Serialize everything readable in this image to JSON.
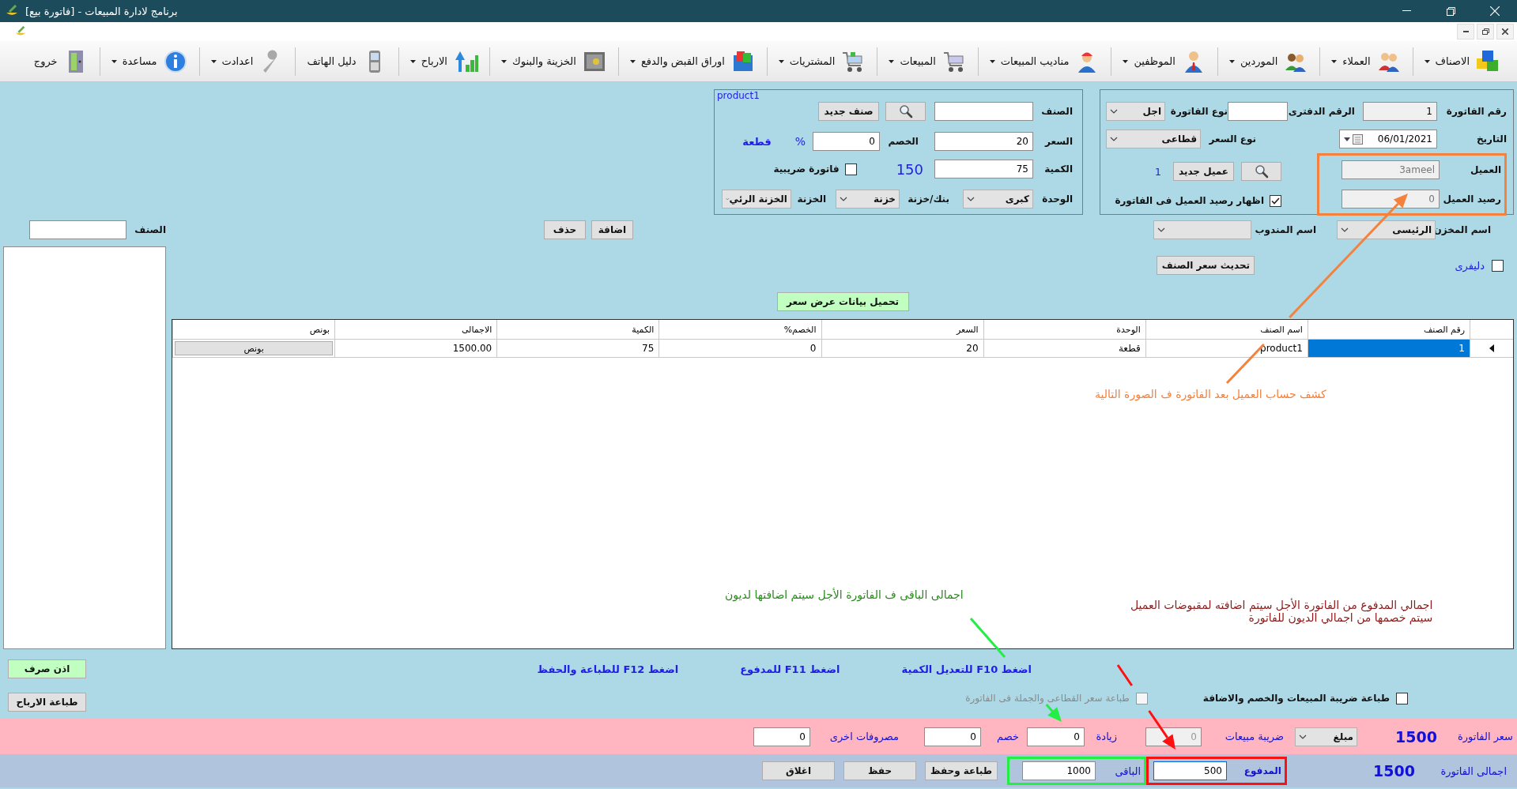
{
  "window": {
    "title": "برنامج لادارة المبيعات - [فاتورة بيع]"
  },
  "toolbar": [
    {
      "label": "الاصناف",
      "dropdown": true
    },
    {
      "label": "العملاء",
      "dropdown": true
    },
    {
      "label": "الموردين",
      "dropdown": true
    },
    {
      "label": "الموظفين",
      "dropdown": true
    },
    {
      "label": "مناديب المبيعات",
      "dropdown": true
    },
    {
      "label": "المبيعات",
      "dropdown": true
    },
    {
      "label": "المشتريات",
      "dropdown": true
    },
    {
      "label": "اوراق القبض والدفع",
      "dropdown": true
    },
    {
      "label": "الخزينة والبنوك",
      "dropdown": true
    },
    {
      "label": "الارباح",
      "dropdown": true
    },
    {
      "label": "دليل الهاتف",
      "dropdown": false
    },
    {
      "label": "اعدادت",
      "dropdown": true
    },
    {
      "label": "مساعدة",
      "dropdown": true
    },
    {
      "label": "خروج",
      "dropdown": false
    }
  ],
  "invoice": {
    "number": {
      "label": "رقم الفاتورة",
      "value": "1"
    },
    "book_number": {
      "label": "الرقم الدفترى"
    },
    "invoice_type": {
      "label": "نوع الفاتورة",
      "value": "اجل"
    },
    "date": {
      "label": "التاريخ",
      "value": "06/01/2021"
    },
    "price_type": {
      "label": "نوع السعر",
      "value": "قطاعى"
    },
    "customer": {
      "label": "العميل",
      "value": "3ameel"
    },
    "balance": {
      "label": "رصيد العميل",
      "value": "0"
    },
    "new_customer_button": "عميل جديد",
    "customer_count": "1",
    "show_balance": {
      "label": "اظهار رصيد العميل فى الفاتورة",
      "checked": true
    }
  },
  "item": {
    "caption": "product1",
    "item": {
      "label": "الصنف"
    },
    "new_item_button": "صنف جديد",
    "price": {
      "label": "السعر",
      "value": "20"
    },
    "discount": {
      "label": "الخصم",
      "value": "0"
    },
    "percent": "%",
    "unit_name": "قطعة",
    "quantity": {
      "label": "الكمية",
      "value": "75"
    },
    "total": "150",
    "tax_invoice": {
      "label": "فاتورة ضريبية",
      "checked": false
    },
    "unit": {
      "label": "الوحدة",
      "value": "كبرى"
    },
    "bank_or_safe": {
      "label": "بنك/خزنة",
      "value": "خزنة"
    },
    "safe": {
      "label": "الخزنة",
      "value": "الخزنة الرئي"
    }
  },
  "store": {
    "label": "اسم المخزن",
    "value": "الرئيسى"
  },
  "rep": {
    "label": "اسم المندوب"
  },
  "add_button": "اضافة",
  "delete_button": "حذف",
  "delivery": {
    "label": "دليفرى",
    "checked": false
  },
  "update_price_button": "تحديث سعر الصنف",
  "load_quote_button": "تحميل بيانات عرض سعر",
  "side": {
    "item_label": "الصنف"
  },
  "table": {
    "columns": [
      "رقم الصنف",
      "اسم الصنف",
      "الوحدة",
      "السعر",
      "الخصم%",
      "الكمية",
      "الاجمالى",
      "بونص"
    ],
    "rows": [
      {
        "cells": [
          "1",
          "product1",
          "قطعة",
          "20",
          "0",
          "75",
          "1500.00"
        ],
        "bonus_button": "بونص",
        "selected": true
      }
    ]
  },
  "hints": [
    "اضغط F10 للتعديل الكمية",
    "اضغط F11 للمدفوع",
    "اضغط F12 للطباعة والحفظ"
  ],
  "side_buttons": [
    {
      "label": "اذن صرف",
      "color": "#c0ffc0"
    },
    {
      "label": "طباعة الارباح",
      "color": "#e1e1e1"
    }
  ],
  "print_options": [
    {
      "label": "طباعة ضريبة المبيعات والخصم والاضافة",
      "checked": false,
      "disabled": false
    },
    {
      "label": "طباعة سعر القطاعى والجملة فى الفاتورة",
      "checked": false,
      "disabled": true
    }
  ],
  "totals": {
    "invoice_price": {
      "label": "سعر الفاتورة",
      "value": "1500"
    },
    "tax_mode": "مبلغ",
    "sales_tax": {
      "label": "ضريبة مبيعات",
      "value": "0",
      "disabled": true
    },
    "increase": {
      "label": "زيادة",
      "value": "0"
    },
    "discount": {
      "label": "خصم",
      "value": "0"
    },
    "other_expenses": {
      "label": "مصروفات اخرى",
      "value": "0"
    }
  },
  "payment": {
    "invoice_total": {
      "label": "اجمالى الفاتورة",
      "value": "1500"
    },
    "paid": {
      "label": "المدفوع",
      "value": "500",
      "focused": true
    },
    "remaining": {
      "label": "الباقى",
      "value": "1000"
    },
    "buttons": [
      "طباعة وحفظ",
      "حفظ",
      "اغلاق"
    ]
  },
  "annotations": [
    {
      "lines": [
        "كشف حساب العميل بعد الفاتورة ف الصورة التالية"
      ],
      "color": "#f4823c",
      "arrow": {
        "color": "#f4823c"
      }
    },
    {
      "lines": [
        "اجمالى الباقى ف الفاتورة الأجل سيتم اضافتها لديون"
      ],
      "color": "#2a8a1e",
      "arrow": {
        "color": "#22ee44"
      }
    },
    {
      "lines": [
        "اجمالي المدفوع  من الفاتورة الأجل سيتم اضافته لمقبوضات العميل",
        "سيتم خصمها من اجمالي الديون للفاتورة"
      ],
      "color": "#8b1a1a",
      "arrow": {
        "color": "#ff1010"
      }
    }
  ]
}
